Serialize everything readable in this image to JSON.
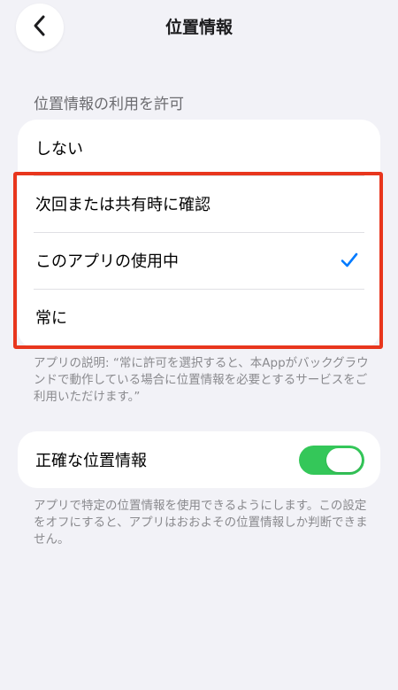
{
  "nav": {
    "title": "位置情報",
    "back_icon": "chevron-left-icon"
  },
  "location_access": {
    "header": "位置情報の利用を許可",
    "options": [
      {
        "label": "しない",
        "selected": false
      },
      {
        "label": "次回または共有時に確認",
        "selected": false
      },
      {
        "label": "このアプリの使用中",
        "selected": true
      },
      {
        "label": "常に",
        "selected": false
      }
    ],
    "checkmark_icon": "checkmark-icon",
    "description": "アプリの説明: “常に許可を選択すると、本Appがバックグラウンドで動作している場合に位置情報を必要とするサービスをご利用いただけます。”"
  },
  "precise_location": {
    "label": "正確な位置情報",
    "enabled": true,
    "description": "アプリで特定の位置情報を使用できるようにします。この設定をオフにすると、アプリはおおよその位置情報しか判断できません。"
  },
  "colors": {
    "accent": "#007aff",
    "toggle_on": "#34c759",
    "highlight": "#e8361d",
    "background": "#f2f2f7"
  }
}
